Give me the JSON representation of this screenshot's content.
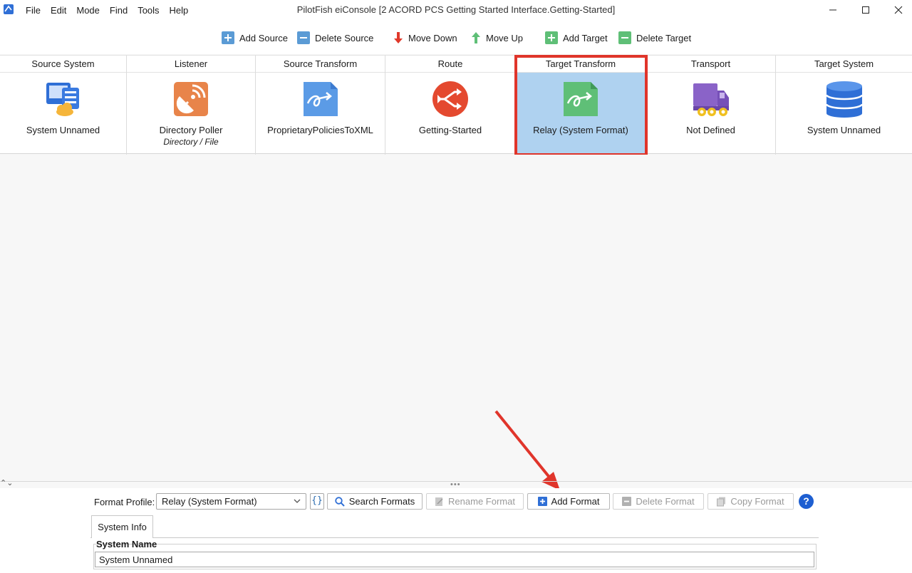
{
  "window": {
    "title": "PilotFish eiConsole [2 ACORD PCS Getting Started Interface.Getting-Started]",
    "menu": [
      "File",
      "Edit",
      "Mode",
      "Find",
      "Tools",
      "Help"
    ],
    "controls": {
      "minimize": "–",
      "maximize": "☐",
      "close": "✕"
    }
  },
  "toolbar": {
    "add_source": "Add Source",
    "delete_source": "Delete Source",
    "move_down": "Move Down",
    "move_up": "Move Up",
    "add_target": "Add Target",
    "delete_target": "Delete Target"
  },
  "stages": [
    {
      "header": "Source System",
      "label": "System Unnamed",
      "sub": "",
      "icon": "source-system-icon"
    },
    {
      "header": "Listener",
      "label": "Directory Poller",
      "sub": "Directory / File",
      "icon": "listener-antenna-icon"
    },
    {
      "header": "Source Transform",
      "label": "ProprietaryPoliciesToXML",
      "sub": "",
      "icon": "transform-document-icon"
    },
    {
      "header": "Route",
      "label": "Getting-Started",
      "sub": "",
      "icon": "route-shuffle-icon"
    },
    {
      "header": "Target Transform",
      "label": "Relay (System Format)",
      "sub": "",
      "icon": "transform-document-icon",
      "selected": true
    },
    {
      "header": "Transport",
      "label": "Not Defined",
      "sub": "",
      "icon": "truck-icon"
    },
    {
      "header": "Target System",
      "label": "System Unnamed",
      "sub": "",
      "icon": "database-icon"
    }
  ],
  "bottom": {
    "format_profile_label": "Format Profile:",
    "format_profile_value": "Relay (System Format)",
    "braces": "{}",
    "search_formats": "Search Formats",
    "rename_format": "Rename Format",
    "add_format": "Add Format",
    "delete_format": "Delete Format",
    "copy_format": "Copy Format",
    "help": "?",
    "tab_system_info": "System Info",
    "system_name_label": "System Name",
    "system_name_value": "System Unnamed"
  },
  "colors": {
    "selection": "#afd2f0",
    "highlight_box": "#e0352b",
    "annotation_arrow": "#e0352b",
    "add_icon": "#5b9bd5",
    "target_icon": "#5fbf77"
  }
}
